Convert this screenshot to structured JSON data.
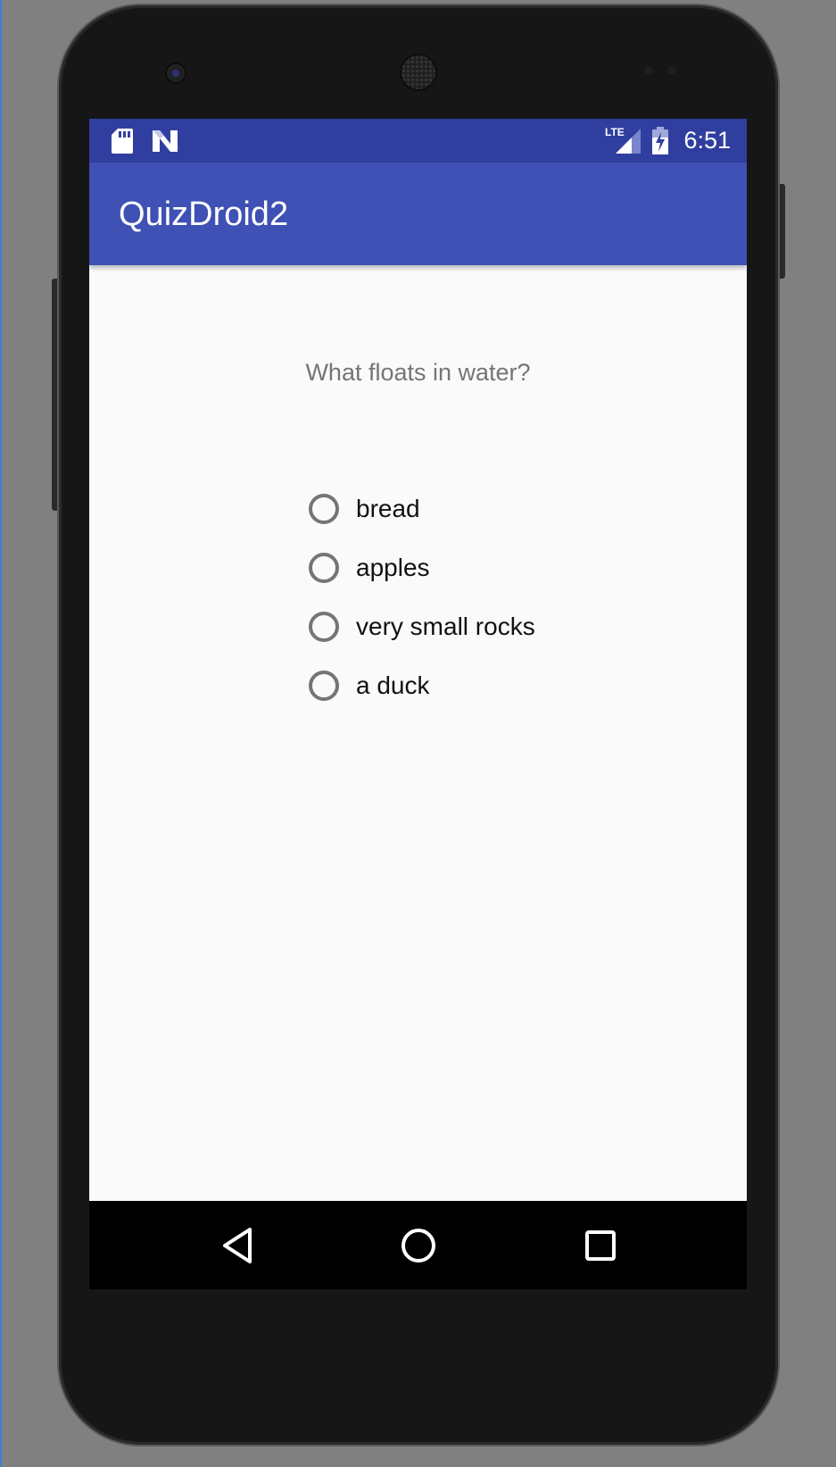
{
  "status_bar": {
    "time": "6:51",
    "network": "LTE",
    "icons": [
      "sd-card-icon",
      "n-notification-icon",
      "lte-signal-icon",
      "battery-charging-icon"
    ]
  },
  "app_bar": {
    "title": "QuizDroid2",
    "color": "#3f51b5",
    "status_color": "#303f9f"
  },
  "quiz": {
    "question": "What floats in water?",
    "options": [
      {
        "label": "bread",
        "selected": false
      },
      {
        "label": "apples",
        "selected": false
      },
      {
        "label": "very small rocks",
        "selected": false
      },
      {
        "label": "a duck",
        "selected": false
      }
    ]
  },
  "nav_bar": {
    "buttons": [
      "back-icon",
      "home-icon",
      "recents-icon"
    ]
  }
}
